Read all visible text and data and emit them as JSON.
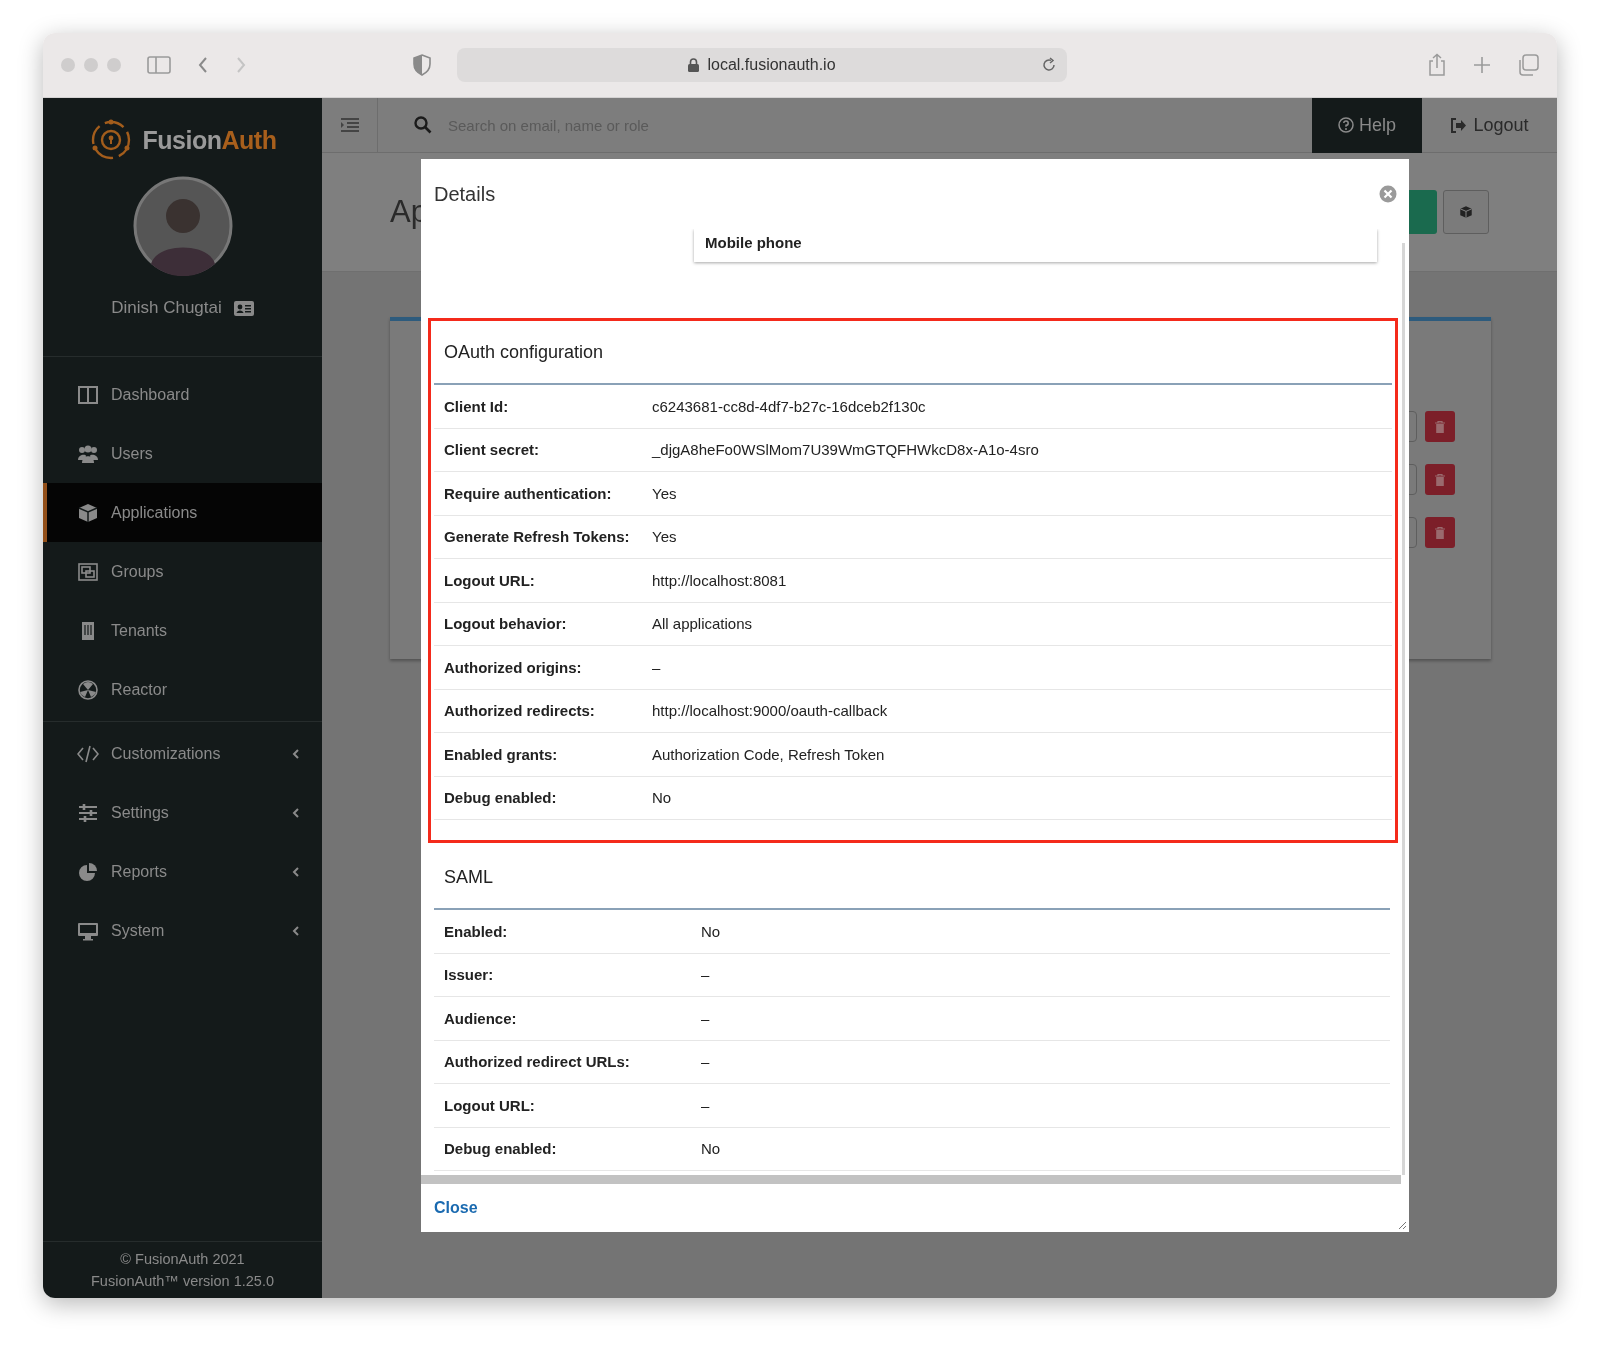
{
  "browser": {
    "url": "local.fusionauth.io"
  },
  "sidebar": {
    "brand_prefix": "Fusion",
    "brand_suffix": "Auth",
    "user_name": "Dinish Chugtai",
    "nav": [
      {
        "label": "Dashboard",
        "kind": "dashboard",
        "selected": false,
        "submenu": false
      },
      {
        "label": "Users",
        "kind": "users",
        "selected": false,
        "submenu": false
      },
      {
        "label": "Applications",
        "kind": "cube",
        "selected": true,
        "submenu": false
      },
      {
        "label": "Groups",
        "kind": "groups",
        "selected": false,
        "submenu": false
      },
      {
        "label": "Tenants",
        "kind": "building",
        "selected": false,
        "submenu": false
      },
      {
        "label": "Reactor",
        "kind": "radiation",
        "selected": false,
        "submenu": false
      },
      {
        "label": "Customizations",
        "kind": "code",
        "selected": false,
        "submenu": true
      },
      {
        "label": "Settings",
        "kind": "sliders",
        "selected": false,
        "submenu": true
      },
      {
        "label": "Reports",
        "kind": "pie",
        "selected": false,
        "submenu": true
      },
      {
        "label": "System",
        "kind": "monitor",
        "selected": false,
        "submenu": true
      }
    ],
    "footer": [
      "© FusionAuth 2021",
      "FusionAuth™ version 1.25.0"
    ]
  },
  "topbar": {
    "search_placeholder": "Search on email, name or role",
    "help": "Help",
    "logout": "Logout"
  },
  "page": {
    "title": "Ap"
  },
  "modal": {
    "title": "Details",
    "partial_field": "Mobile phone",
    "sections": [
      {
        "title": "OAuth configuration",
        "highlighted": true,
        "rows": [
          {
            "label": "Client Id:",
            "value": "c6243681-cc8d-4df7-b27c-16dceb2f130c"
          },
          {
            "label": "Client secret:",
            "value": "_djgA8heFo0WSlMom7U39WmGTQFHWkcD8x-A1o-4sro"
          },
          {
            "label": "Require authentication:",
            "value": "Yes"
          },
          {
            "label": "Generate Refresh Tokens:",
            "value": "Yes"
          },
          {
            "label": "Logout URL:",
            "value": "http://localhost:8081"
          },
          {
            "label": "Logout behavior:",
            "value": "All applications"
          },
          {
            "label": "Authorized origins:",
            "value": "–"
          },
          {
            "label": "Authorized redirects:",
            "value": "http://localhost:9000/oauth-callback"
          },
          {
            "label": "Enabled grants:",
            "value": "Authorization Code, Refresh Token"
          },
          {
            "label": "Debug enabled:",
            "value": "No"
          }
        ]
      },
      {
        "title": "SAML",
        "highlighted": false,
        "rows": [
          {
            "label": "Enabled:",
            "value": "No"
          },
          {
            "label": "Issuer:",
            "value": "–"
          },
          {
            "label": "Audience:",
            "value": "–"
          },
          {
            "label": "Authorized redirect URLs:",
            "value": "–"
          },
          {
            "label": "Logout URL:",
            "value": "–"
          },
          {
            "label": "Debug enabled:",
            "value": "No"
          }
        ]
      }
    ],
    "close": "Close"
  }
}
